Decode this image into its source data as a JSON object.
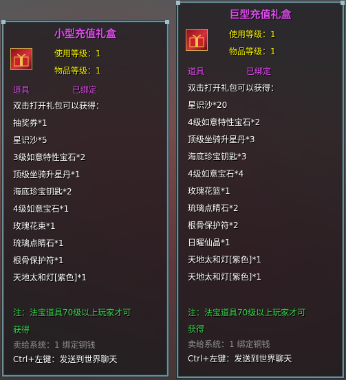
{
  "left": {
    "title": "小型充值礼盒",
    "use_level_label": "使用等级：",
    "use_level_value": "1",
    "item_level_label": "物品等级：",
    "item_level_value": "1",
    "type": "道具",
    "bound": "已绑定",
    "intro": "双击打开礼包可以获得：",
    "rewards": [
      "抽奖券*1",
      "星识沙*5",
      "3级如意特性宝石*2",
      "顶级坐骑升星丹*1",
      "海底珍宝钥匙*2",
      "4级如意宝石*1",
      "玫瑰花束*1",
      "琉璃点睛石*1",
      "根骨保护符*1",
      "天地太和灯[紫色]*1"
    ],
    "note_line1": "注：法宝道具70级以上玩家才可",
    "note_line2": "获得",
    "sell": "卖给系统：1 绑定铜钱",
    "ctrl_hint": "Ctrl+左键：发送到世界聊天"
  },
  "right": {
    "title": "巨型充值礼盒",
    "use_level_label": "使用等级：",
    "use_level_value": "1",
    "item_level_label": "物品等级：",
    "item_level_value": "1",
    "type": "道具",
    "bound": "已绑定",
    "intro": "双击打开礼包可以获得：",
    "rewards": [
      "星识沙*20",
      "4级如意特性宝石*2",
      "顶级坐骑升星丹*3",
      "海底珍宝钥匙*3",
      "4级如意宝石*4",
      "玫瑰花篮*1",
      "琉璃点睛石*2",
      "根骨保护符*2",
      "日曜仙晶*1",
      "天地太和灯[紫色]*1",
      "天地太和灯[紫色]*1"
    ],
    "note_line1": "注：法宝道具70级以上玩家才可",
    "note_line2": "获得",
    "sell": "卖给系统：1 绑定铜钱",
    "ctrl_hint": "Ctrl+左键：发送到世界聊天"
  },
  "colors": {
    "title": "#e04cf0",
    "level": "#f4f000",
    "note": "#35d94b",
    "sell": "#8f8f8f",
    "border": "#6f8f9a"
  },
  "icons": {
    "left_item": "gift-box-icon",
    "right_item": "gift-box-icon"
  }
}
